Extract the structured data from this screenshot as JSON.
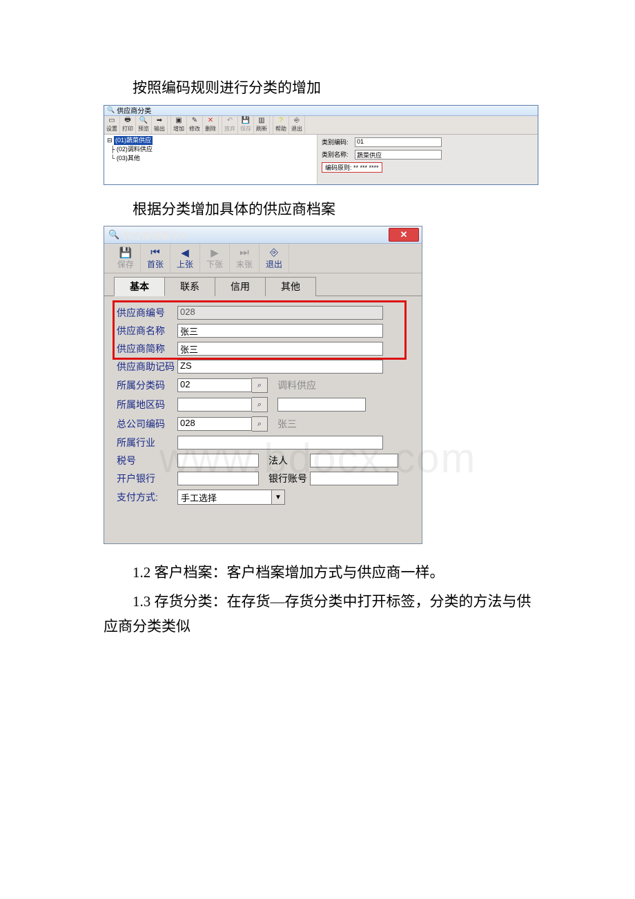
{
  "doc": {
    "line1": "按照编码规则进行分类的增加",
    "line2": "根据分类增加具体的供应商档案",
    "line3": "1.2 客户档案：客户档案增加方式与供应商一样。",
    "line4": "1.3 存货分类：在存货—存货分类中打开标签，分类的方法与供应商分类类似"
  },
  "win1": {
    "title": "供应商分类",
    "toolbar": {
      "setup": "设置",
      "print": "打印",
      "preview": "预览",
      "output": "输出",
      "add": "增加",
      "modify": "修改",
      "delete": "删除",
      "abort": "放弃",
      "save": "保存",
      "refresh": "刷新",
      "help": "帮助",
      "exit": "退出"
    },
    "tree": {
      "i1": "(01)蔬菜供应",
      "i2": "(02)调料供应",
      "i3": "(03)其他"
    },
    "form": {
      "code_label": "类别编码:",
      "code_value": "01",
      "name_label": "类别名称:",
      "name_value": "蔬菜供应",
      "rule_label": "编码原则:",
      "rule_value": "** *** ****"
    }
  },
  "win2": {
    "title": "供应商档案卡片",
    "close": "✕",
    "toolbar": {
      "save": "保存",
      "first": "首张",
      "prev": "上张",
      "next": "下张",
      "last": "末张",
      "exit": "退出"
    },
    "tabs": {
      "t1": "基本",
      "t2": "联系",
      "t3": "信用",
      "t4": "其他"
    },
    "form": {
      "supplier_no_label": "供应商编号",
      "supplier_no": "028",
      "supplier_name_label": "供应商名称",
      "supplier_name": "张三",
      "supplier_short_label": "供应商简称",
      "supplier_short": "张三",
      "supplier_mnemonic_label": "供应商助记码",
      "supplier_mnemonic": "ZS",
      "category_code_label": "所属分类码",
      "category_code": "02",
      "category_name": "调料供应",
      "region_code_label": "所属地区码",
      "region_code": "",
      "hq_code_label": "总公司编码",
      "hq_code": "028",
      "hq_name": "张三",
      "industry_label": "所属行业",
      "industry": "",
      "tax_no_label": "税号",
      "legal_person_label": "法人",
      "bank_label": "开户银行",
      "bank_account_label": "银行账号",
      "pay_method_label": "支付方式:",
      "pay_method_value": "手工选择"
    },
    "watermark": "www.bdocx.com"
  }
}
